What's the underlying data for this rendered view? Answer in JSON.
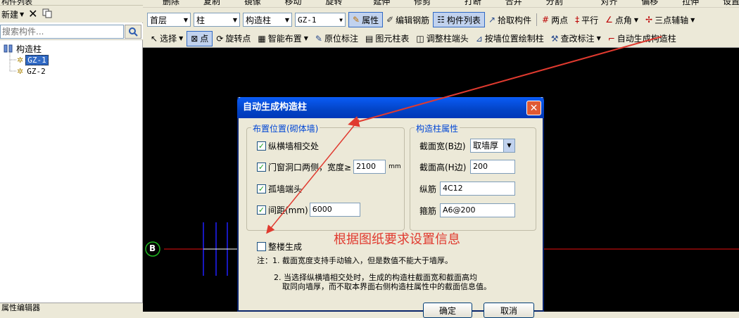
{
  "left_panel": {
    "top_strip": "构件列表",
    "new_label": "新建",
    "search_placeholder": "搜索构件...",
    "tree": {
      "root": "构造柱",
      "items": [
        "GZ-1",
        "GZ-2"
      ]
    },
    "bottom_label": "属性编辑器"
  },
  "toolbar0": {
    "items": [
      "删除",
      "复制",
      "镜像",
      "移动",
      "旋转",
      "延伸",
      "修剪",
      "打断",
      "合并",
      "分割",
      "对齐",
      "偏移",
      "拉伸",
      "设置夹点"
    ]
  },
  "toolbar1": {
    "floor": "首层",
    "type": "柱",
    "subtype": "构造柱",
    "component": "GZ-1",
    "attr_btn": "属性",
    "edit_rebar": "编辑钢筋",
    "comp_list": "构件列表",
    "pick": "拾取构件",
    "two_points": "两点",
    "parallel": "平行",
    "point_angle": "点角",
    "three_point_aux": "三点辅轴"
  },
  "toolbar2": {
    "select": "选择",
    "point": "点",
    "rotate_point": "旋转点",
    "smart_layout": "智能布置",
    "original_mark": "原位标注",
    "column_table": "图元柱表",
    "adjust_column_end": "调整柱端头",
    "draw_by_wall": "按墙位置绘制柱",
    "check_mark": "查改标注",
    "auto_generate": "自动生成构造柱"
  },
  "canvas": {
    "axis_label": "B"
  },
  "annotation": {
    "text": "根据图纸要求设置信息",
    "color": "#e03a2f"
  },
  "dialog": {
    "title": "自动生成构造柱",
    "layout_group": {
      "title": "布置位置(砌体墙)",
      "options": [
        {
          "label": "纵横墙相交处",
          "checked": true
        },
        {
          "label": "门窗洞口两侧，宽度≥",
          "checked": true,
          "value": "2100",
          "unit": "mm"
        },
        {
          "label": "孤墙端头",
          "checked": true
        },
        {
          "label": "间距(mm)",
          "checked": true,
          "value": "6000"
        }
      ]
    },
    "props_group": {
      "title": "构造柱属性",
      "fields": [
        {
          "label": "截面宽(B边)",
          "value": "取墙厚"
        },
        {
          "label": "截面高(H边)",
          "value": "200"
        },
        {
          "label": "纵筋",
          "value": "4C12"
        },
        {
          "label": "箍筋",
          "value": "A6@200"
        }
      ]
    },
    "whole_building": {
      "label": "整楼生成",
      "checked": false
    },
    "note1": "注：1. 截面宽度支持手动输入，但是数值不能大于墙厚。",
    "note2": "2. 当选择纵横墙相交处时，生成的构造柱截面宽和截面高均",
    "note3": "取同向墙厚，而不取本界面右侧构造柱属性中的截面信息值。",
    "ok": "确定",
    "cancel": "取消"
  }
}
